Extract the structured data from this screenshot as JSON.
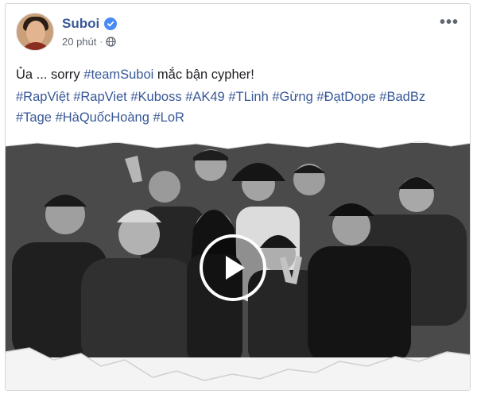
{
  "post": {
    "author": "Suboi",
    "time": "20 phút",
    "separator": "·",
    "text": "Ủa ... sorry #teamSuboi mắc bận cypher!",
    "text_parts": {
      "before": "Ủa ... sorry ",
      "tag": "#teamSuboi",
      "after": " mắc bận cypher!"
    },
    "hashtags_line1": [
      "#RapViệt",
      "#RapViet",
      "#Kuboss",
      "#AK49",
      "#TLinh",
      "#Gừng",
      "#ĐạtDope",
      "#BadBz"
    ],
    "hashtags_line2": [
      "#Tage",
      "#HàQuốcHoàng",
      "#LoR"
    ],
    "more_icon": "•••"
  },
  "colors": {
    "link": "#385898",
    "verified": "#4a8af4",
    "meta": "#606770",
    "text": "#1c1e21"
  },
  "icons": {
    "verified": "verified-badge-icon",
    "privacy": "globe-icon",
    "more": "more-options-icon",
    "play": "play-icon"
  }
}
